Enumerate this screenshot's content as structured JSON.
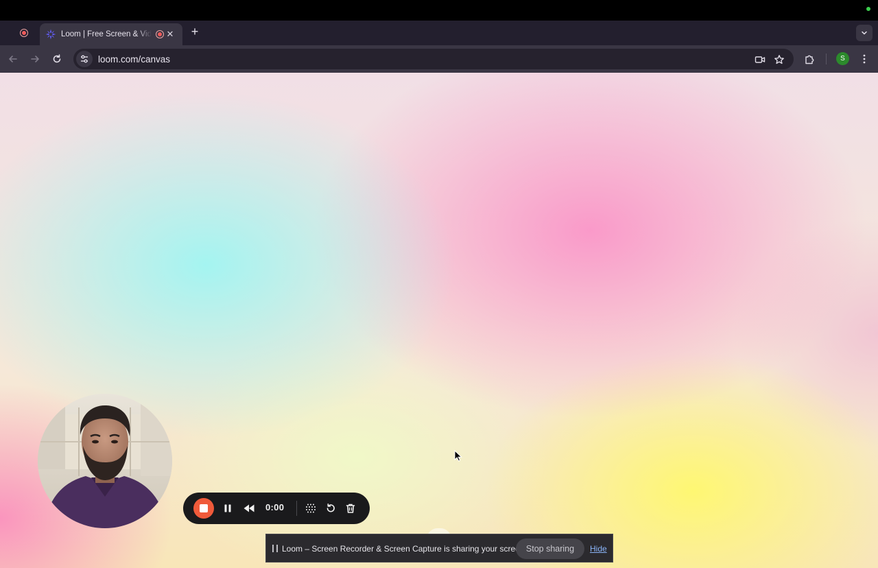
{
  "browser": {
    "tabs": [
      {
        "title": "Loom | Free Screen & Video Recording",
        "recording": true,
        "active": true
      }
    ],
    "url": "loom.com/canvas",
    "profile_initial": "S",
    "icons": {
      "back": "back-arrow-icon",
      "forward": "forward-arrow-icon",
      "reload": "reload-icon",
      "site_info": "site-settings-icon",
      "camera": "camera-in-use-icon",
      "bookmark": "bookmark-star-icon",
      "extensions": "puzzle-icon",
      "menu": "kebab-menu-icon",
      "tab_search": "chevron-down-icon",
      "new_tab": "plus-icon",
      "close_tab": "close-icon"
    }
  },
  "recorder": {
    "timer": "0:00",
    "controls": [
      "stop-recording",
      "pause",
      "rewind",
      "drawing-tools",
      "restart",
      "delete"
    ],
    "accent_color": "#f05a3a"
  },
  "share_bar": {
    "message": "Loom – Screen Recorder & Screen Capture is sharing your screen.",
    "stop_label": "Stop sharing",
    "hide_label": "Hide"
  },
  "close_glyph": "✕",
  "new_tab_glyph": "+"
}
